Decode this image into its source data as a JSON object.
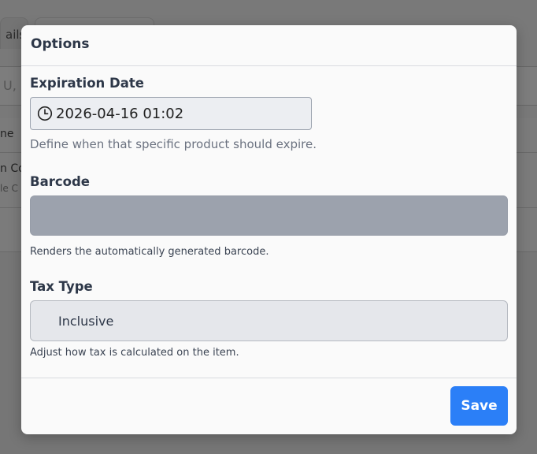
{
  "background": {
    "tab_partial_label": "ails",
    "search_partial": "U, B",
    "row_header_partial": "ne",
    "row_title_partial": "n Co",
    "row_meta_partial": "le  C"
  },
  "modal": {
    "title": "Options",
    "expiration": {
      "label": "Expiration Date",
      "value": "2026-04-16 01:02",
      "help": "Define when that specific product should expire."
    },
    "barcode": {
      "label": "Barcode",
      "help": "Renders the automatically generated barcode."
    },
    "tax_type": {
      "label": "Tax Type",
      "value": "Inclusive",
      "help": "Adjust how tax is calculated on the item."
    },
    "save_label": "Save"
  },
  "colors": {
    "accent": "#2b7ff7",
    "heading": "#2d3748",
    "barcode_placeholder": "#9ca2ad"
  },
  "icons": {
    "date_icon": "clock-icon"
  }
}
